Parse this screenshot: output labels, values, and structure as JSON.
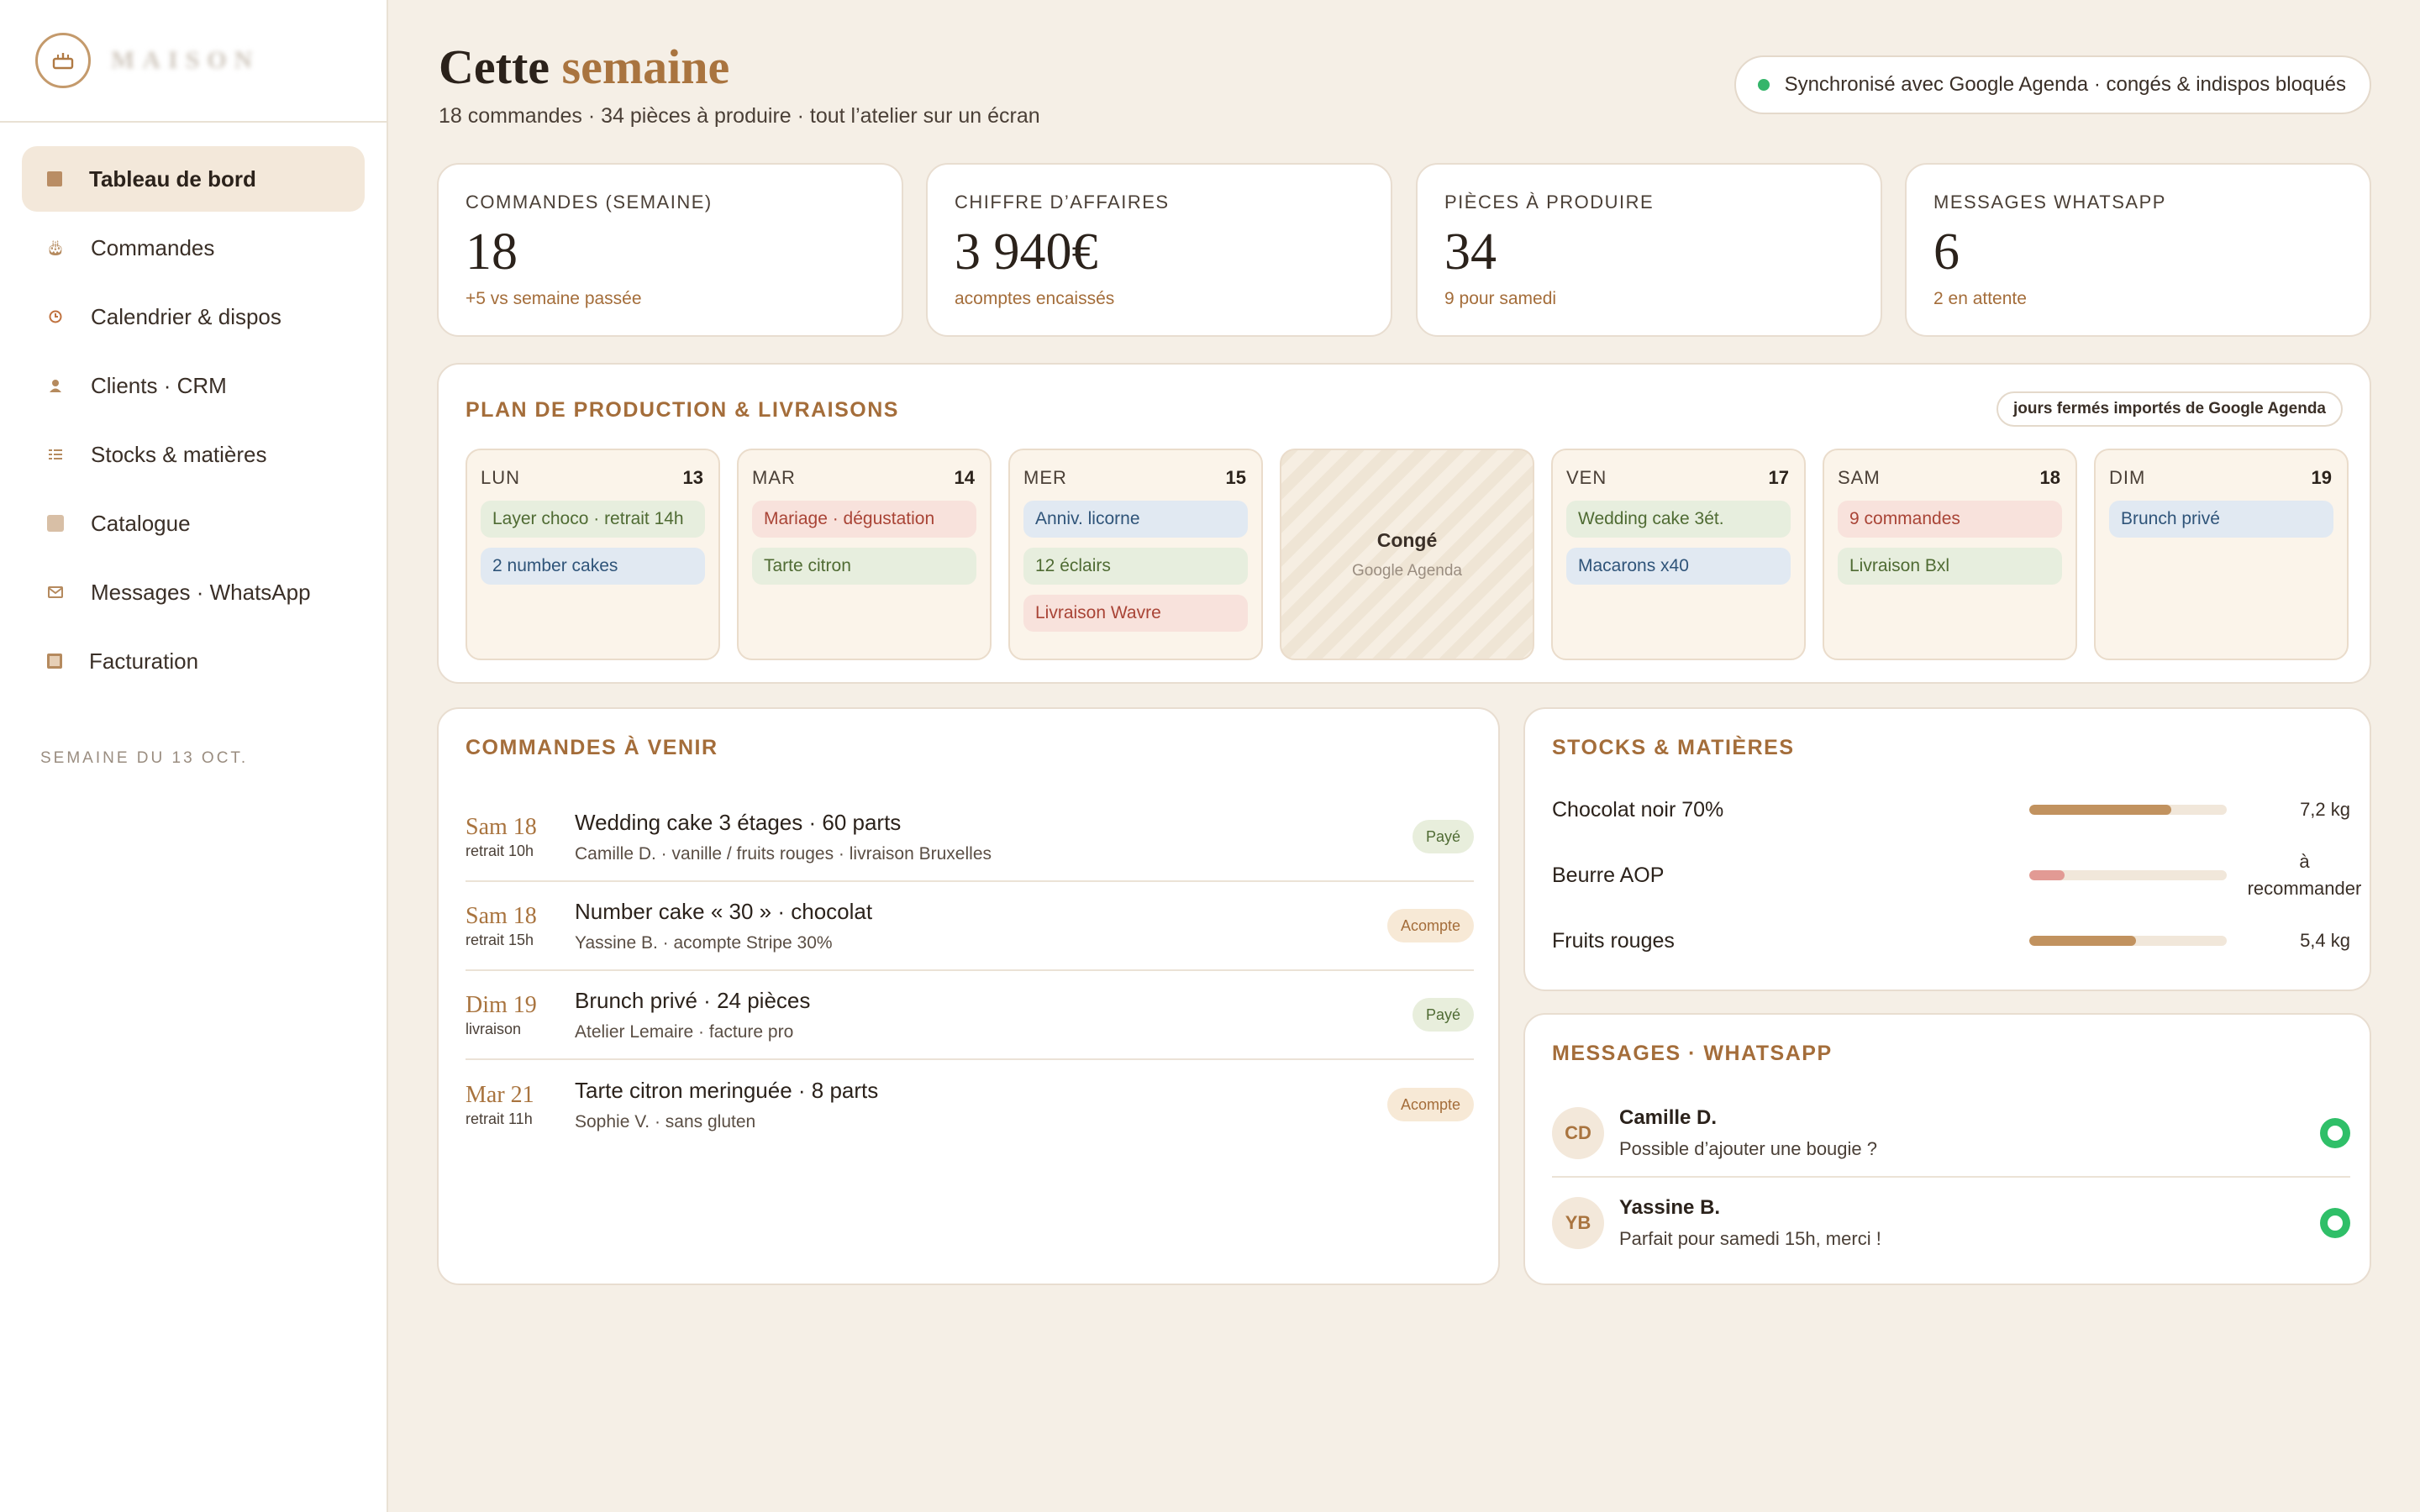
{
  "sidebar": {
    "brand_icon": "cake-icon",
    "brand_name": "MAISON",
    "items": [
      {
        "label": "Tableau de bord",
        "icon": "dashboard-icon",
        "active": true
      },
      {
        "label": "Commandes",
        "icon": "cake-icon"
      },
      {
        "label": "Calendrier & dispos",
        "icon": "clock-icon"
      },
      {
        "label": "Clients · CRM",
        "icon": "client-icon"
      },
      {
        "label": "Stocks & matières",
        "icon": "list-icon"
      },
      {
        "label": "Catalogue",
        "icon": "catalog-icon"
      },
      {
        "label": "Messages · WhatsApp",
        "icon": "envelope-icon"
      },
      {
        "label": "Facturation",
        "icon": "invoice-icon"
      }
    ],
    "week_label": "SEMAINE DU 13 OCT."
  },
  "header": {
    "title_start": "Cette",
    "title_accent": "semaine",
    "subtitle": "18 commandes · 34 pièces à produire · tout l’atelier sur un écran",
    "sync_text": "Synchronisé avec Google Agenda · congés & indispos bloqués"
  },
  "kpis": [
    {
      "label": "COMMANDES (SEMAINE)",
      "value": "18",
      "note": "+5 vs semaine passée"
    },
    {
      "label": "CHIFFRE D’AFFAIRES",
      "value": "3 940€",
      "note": "acomptes encaissés"
    },
    {
      "label": "PIÈCES À PRODUIRE",
      "value": "34",
      "note": "9 pour samedi"
    },
    {
      "label": "MESSAGES WHATSAPP",
      "value": "6",
      "note": "2 en attente"
    }
  ],
  "plan": {
    "title": "PLAN DE PRODUCTION & LIVRAISONS",
    "pill": "jours fermés importés de Google Agenda",
    "days": [
      {
        "name": "LUN",
        "num": "13",
        "chips": [
          {
            "text": "Layer choco · retrait 14h",
            "tone": "green"
          },
          {
            "text": "2 number cakes",
            "tone": "blue"
          }
        ]
      },
      {
        "name": "MAR",
        "num": "14",
        "chips": [
          {
            "text": "Mariage · dégustation",
            "tone": "red"
          },
          {
            "text": "Tarte citron",
            "tone": "green"
          }
        ]
      },
      {
        "name": "MER",
        "num": "15",
        "chips": [
          {
            "text": "Anniv. licorne",
            "tone": "blue"
          },
          {
            "text": "12 éclairs",
            "tone": "green"
          },
          {
            "text": "Livraison Wavre",
            "tone": "red"
          }
        ]
      },
      {
        "off": true,
        "title": "Congé",
        "sub": "Google Agenda"
      },
      {
        "name": "VEN",
        "num": "17",
        "chips": [
          {
            "text": "Wedding cake 3ét.",
            "tone": "green"
          },
          {
            "text": "Macarons x40",
            "tone": "blue"
          }
        ]
      },
      {
        "name": "SAM",
        "num": "18",
        "chips": [
          {
            "text": "9 commandes",
            "tone": "red"
          },
          {
            "text": "Livraison Bxl",
            "tone": "green"
          }
        ]
      },
      {
        "name": "DIM",
        "num": "19",
        "chips": [
          {
            "text": "Brunch privé",
            "tone": "blue"
          }
        ]
      }
    ]
  },
  "orders": {
    "title": "COMMANDES À VENIR",
    "rows": [
      {
        "date": "Sam 18",
        "when": "retrait 10h",
        "title": "Wedding cake 3 étages · 60 parts",
        "detail": "Camille D. · vanille / fruits rouges · livraison Bruxelles",
        "status": "Payé",
        "status_type": "paid"
      },
      {
        "date": "Sam 18",
        "when": "retrait 15h",
        "title": "Number cake « 30 » · chocolat",
        "detail": "Yassine B. · acompte Stripe 30%",
        "status": "Acompte",
        "status_type": "deposit"
      },
      {
        "date": "Dim 19",
        "when": "livraison",
        "title": "Brunch privé · 24 pièces",
        "detail": "Atelier Lemaire · facture pro",
        "status": "Payé",
        "status_type": "paid"
      },
      {
        "date": "Mar 21",
        "when": "retrait 11h",
        "title": "Tarte citron meringuée · 8 parts",
        "detail": "Sophie V. · sans gluten",
        "status": "Acompte",
        "status_type": "deposit"
      }
    ]
  },
  "stocks": {
    "title": "STOCKS & MATIÈRES",
    "items": [
      {
        "name": "Chocolat noir 70%",
        "level": 0.72,
        "value": "7,2 kg",
        "color": "#c1925f"
      },
      {
        "name": "Beurre AOP",
        "level": 0.18,
        "value": "à recommander",
        "color": "#e29a94"
      },
      {
        "name": "Fruits rouges",
        "level": 0.54,
        "value": "5,4 kg",
        "color": "#c1925f"
      }
    ]
  },
  "whatsapp": {
    "title": "MESSAGES · WHATSAPP",
    "messages": [
      {
        "initials": "CD",
        "name": "Camille D.",
        "text": "Possible d’ajouter une bougie ?"
      },
      {
        "initials": "YB",
        "name": "Yassine B.",
        "text": "Parfait pour samedi 15h, merci !"
      }
    ]
  }
}
